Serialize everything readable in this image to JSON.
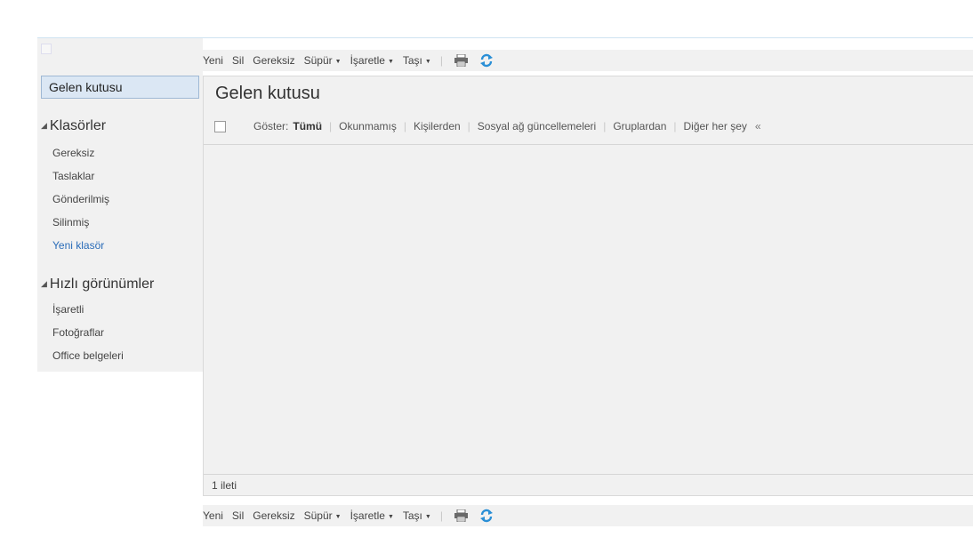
{
  "sidebar": {
    "inbox": "Gelen kutusu",
    "folders_header": "Klasörler",
    "folders": [
      {
        "label": "Gereksiz"
      },
      {
        "label": "Taslaklar"
      },
      {
        "label": "Gönderilmiş"
      },
      {
        "label": "Silinmiş"
      },
      {
        "label": "Yeni klasör"
      }
    ],
    "quick_header": "Hızlı görünümler",
    "quick_views": [
      {
        "label": "İşaretli"
      },
      {
        "label": "Fotoğraflar"
      },
      {
        "label": "Office belgeleri"
      }
    ]
  },
  "toolbar": {
    "new": "Yeni",
    "delete": "Sil",
    "junk": "Gereksiz",
    "sweep": "Süpür",
    "mark": "İşaretle",
    "move": "Taşı",
    "print_icon": "print-icon",
    "refresh_icon": "refresh-icon"
  },
  "main": {
    "title": "Gelen kutusu",
    "filter": {
      "show_label": "Göster:",
      "all": "Tümü",
      "options": [
        {
          "label": "Okunmamış"
        },
        {
          "label": "Kişilerden"
        },
        {
          "label": "Sosyal ağ güncellemeleri"
        },
        {
          "label": "Gruplardan"
        },
        {
          "label": "Diğer her şey"
        }
      ],
      "collapse": "«"
    },
    "message_count": "1 ileti"
  },
  "colors": {
    "accent": "#2a6cb8",
    "selected_bg": "#dbe7f4",
    "panel_bg": "#f1f1f1"
  }
}
